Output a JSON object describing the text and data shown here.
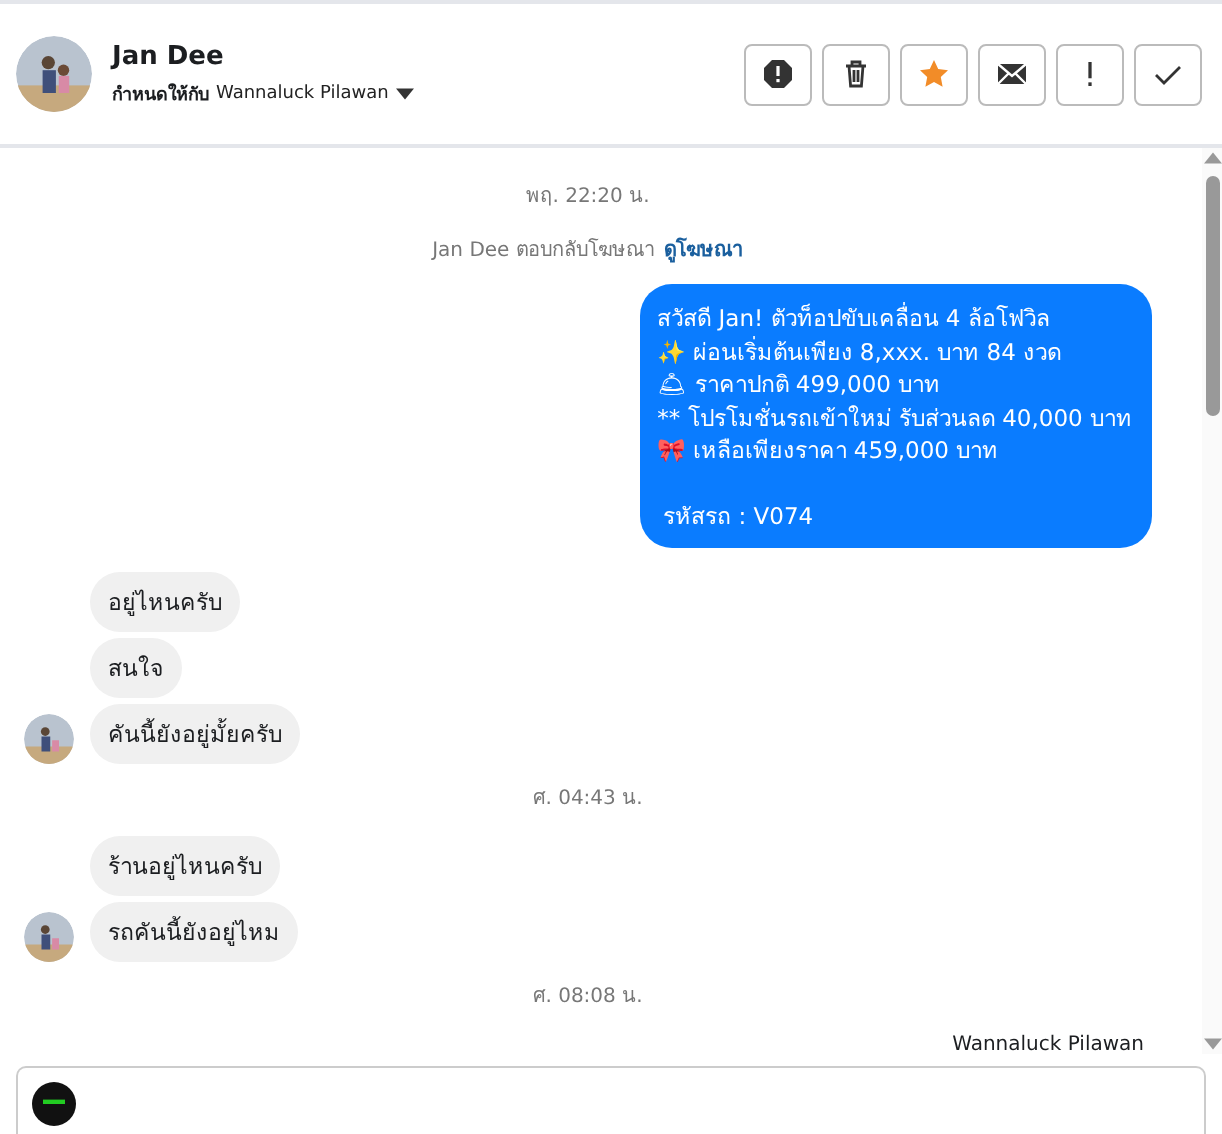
{
  "header": {
    "name": "Jan Dee",
    "assign_label": "กำหนดให้กับ",
    "assignee": "Wannaluck Pilawan",
    "actions": [
      {
        "kind": "alert"
      },
      {
        "kind": "trash"
      },
      {
        "kind": "star"
      },
      {
        "kind": "mail"
      },
      {
        "kind": "exclaim"
      },
      {
        "kind": "check"
      }
    ]
  },
  "messages": [
    {
      "kind": "time",
      "text": "พฤ. 22:20 น."
    },
    {
      "kind": "notice",
      "text": "Jan Dee ตอบกลับโฆษณา",
      "link": "ดูโฆษณา"
    },
    {
      "kind": "outgoing",
      "lines": [
        "สวัสดี Jan! ตัวท็อปขับเคลื่อน 4 ล้อโฟวิล",
        "✨  ผ่อนเริ่มต้นเพียง 8,xxx. บาท 84 งวด",
        "🛎  ราคาปกติ 499,000 บาท",
        "** โปรโมชั่นรถเข้าใหม่ รับส่วนลด 40,000 บาท",
        "🎀  เหลือเพียงราคา 459,000 บาท"
      ],
      "footer": "รหัสรถ : V074"
    },
    {
      "kind": "incoming",
      "text": "อยู่ไหนครับ",
      "avatar": false
    },
    {
      "kind": "incoming",
      "text": "สนใจ",
      "avatar": false
    },
    {
      "kind": "incoming",
      "text": "คันนี้ยังอยู่มั้ยครับ",
      "avatar": true
    },
    {
      "kind": "time",
      "text": "ศ. 04:43 น."
    },
    {
      "kind": "incoming",
      "text": "ร้านอยู่ไหนครับ",
      "avatar": false
    },
    {
      "kind": "incoming",
      "text": "รถคันนี้ยังอยู่ไหม",
      "avatar": true
    },
    {
      "kind": "time",
      "text": "ศ. 08:08 น."
    },
    {
      "kind": "sender",
      "text": "Wannaluck Pilawan"
    }
  ]
}
